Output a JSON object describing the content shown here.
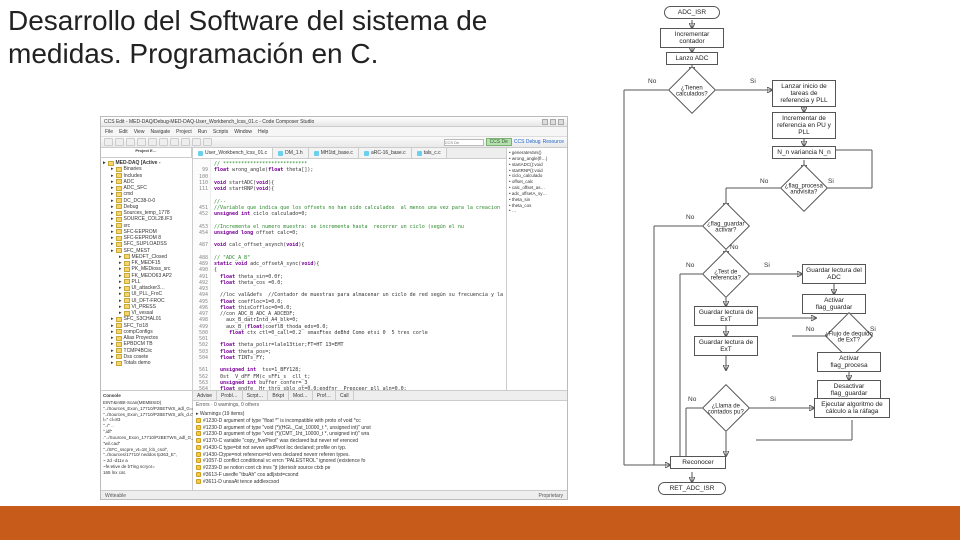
{
  "title_line1": "Desarrollo del Software del sistema de",
  "title_line2": "medidas. Programación en C.",
  "ide": {
    "window_title": "CCS Edit - MED-DAQ/Debug-MED-DAQ-User_Workbench_lcss_01.c - Code Composer Studio",
    "menus": [
      "File",
      "Edit",
      "View",
      "Navigate",
      "Project",
      "Run",
      "Scripts",
      "Window",
      "Help"
    ],
    "toolbar": {
      "build": "CCS De",
      "debug": "CCS Debug",
      "resource": "Resource"
    },
    "side_tabs": [
      "Project E…"
    ],
    "tree": [
      {
        "label": "MED-DAQ [Active - ",
        "bold": true,
        "indent": 0
      },
      {
        "label": "Binaries",
        "indent": 1
      },
      {
        "label": "Includes",
        "indent": 1
      },
      {
        "label": "ADC",
        "indent": 1
      },
      {
        "label": "ADC_SFC",
        "indent": 1
      },
      {
        "label": "cmd",
        "indent": 1
      },
      {
        "label": "DC_DC38-0-0",
        "indent": 1
      },
      {
        "label": "Debug",
        "indent": 1
      },
      {
        "label": "Sources_temp_1778",
        "indent": 1
      },
      {
        "label": "SOURCE_COL28.IF3",
        "indent": 1
      },
      {
        "label": "src",
        "indent": 1
      },
      {
        "label": "SFC-EEPROM",
        "indent": 1
      },
      {
        "label": "SFC-EEPROM 8",
        "indent": 1
      },
      {
        "label": "SFC_SUPLOADSS",
        "indent": 1
      },
      {
        "label": "SFC_MEST",
        "indent": 1
      },
      {
        "label": "MEDFT_Closed",
        "indent": 2
      },
      {
        "label": "FK_MEDF15",
        "indent": 2
      },
      {
        "label": "PK_MEDioss_src",
        "indent": 2
      },
      {
        "label": "FK_MEDO63 AP2",
        "indent": 2
      },
      {
        "label": "PLL",
        "indent": 2
      },
      {
        "label": "UI_attacker3…",
        "indent": 2
      },
      {
        "label": "UI_PLL_FroC",
        "indent": 2
      },
      {
        "label": "UI_DFT-FROC",
        "indent": 2
      },
      {
        "label": "VI_PRESS",
        "indent": 2
      },
      {
        "label": "VI_vessal",
        "indent": 2
      },
      {
        "label": "SFC_S3CHAL01",
        "indent": 1
      },
      {
        "label": "SFC_Tci18",
        "indent": 1
      },
      {
        "label": "compConfigs",
        "indent": 1
      },
      {
        "label": "Alias Proyectos",
        "indent": 1
      },
      {
        "label": "EPBDCM TB",
        "indent": 1
      },
      {
        "label": "TCMP4BCiic",
        "indent": 1
      },
      {
        "label": "Dss cosete",
        "indent": 1
      },
      {
        "label": "Totals demo",
        "indent": 1
      }
    ],
    "editor_tabs": [
      {
        "label": "User_Workbench_lcss_01.c",
        "active": true
      },
      {
        "label": "DM_1.h",
        "active": false
      },
      {
        "label": "MH1td_base.c",
        "active": false
      },
      {
        "label": "aRC-16_base.c",
        "active": false
      },
      {
        "label": "tals_c.c",
        "active": false
      }
    ],
    "code_lines": [
      {
        "n": "",
        "t": "// ****************************"
      },
      {
        "n": "99",
        "t": "float wrong_angle(float theta[]);"
      },
      {
        "n": "100",
        "t": ""
      },
      {
        "n": "110",
        "t": "void startADC(void){"
      },
      {
        "n": "111",
        "t": "void startRNP(void){"
      },
      {
        "n": "",
        "t": ""
      },
      {
        "n": "",
        "t": "//--"
      },
      {
        "n": "451",
        "t": "//Variable que indica que los offsets no han sido calculados  al menos una vez para la creacion"
      },
      {
        "n": "452",
        "t": "unsigned int ciclo calculado=0;"
      },
      {
        "n": "",
        "t": ""
      },
      {
        "n": "453",
        "t": "//Incrementa el numero muestra: se incrementa hasta  recorrer un ciclo (según el nu"
      },
      {
        "n": "454",
        "t": "unsigned long offset calc=0;"
      },
      {
        "n": "",
        "t": ""
      },
      {
        "n": "487",
        "t": "void calc_offset_asynch(void){"
      },
      {
        "n": "",
        "t": ""
      },
      {
        "n": "488",
        "t": "// \"ADC_A_B\""
      },
      {
        "n": "489",
        "t": "static void adc_offsetA_sync(void){"
      },
      {
        "n": "490",
        "t": "{"
      },
      {
        "n": "491",
        "t": "  float theta_sin=0.0f;"
      },
      {
        "n": "492",
        "t": "  float theta_cos =0.0;"
      },
      {
        "n": "493",
        "t": ""
      },
      {
        "n": "494",
        "t": "  //loc val&defs  //Contador de muestras para almacenar un ciclo de red según su frecuencia y la"
      },
      {
        "n": "495",
        "t": "  float coeffloc=1=0.0;"
      },
      {
        "n": "496",
        "t": "  float thisCoffloc=0=0.0;"
      },
      {
        "n": "497",
        "t": "  //con ADC_B ADC_A ADCEDF;"
      },
      {
        "n": "498",
        "t": "    aux_B_datrIntd_A4_blk=0;"
      },
      {
        "n": "499",
        "t": "    aux_B_(float)coeflB_thoda_eds=0.0;"
      },
      {
        "n": "500",
        "t": "     float ctx ctl=0_call=0.2  smaxFtex deBhd Como etsi 0  5 tres corle"
      },
      {
        "n": "501",
        "t": ""
      },
      {
        "n": "502",
        "t": "  float theta_polir=lale13tier;FT=HT 13=EMT"
      },
      {
        "n": "503",
        "t": "  float theta_pos=;"
      },
      {
        "n": "504",
        "t": "  float TINTs_FY;"
      },
      {
        "n": "",
        "t": ""
      },
      {
        "n": "561",
        "t": "  unsigned int  tss=1_BFY128;"
      },
      {
        "n": "562",
        "t": "  0st  V_dFF FM(c_sFFi_s  cll_t;"
      },
      {
        "n": "563",
        "t": "  unsigned int buffer_confer=_3_"
      },
      {
        "n": "564",
        "t": "  float endfe  Hr thro_sblo_ot=0.0;endfnr  Preoceer_pll_aln=0.0;"
      }
    ],
    "outline": [
      "generateVars()",
      "wrong_angle(fl…)",
      "startADC():void",
      "startRNP():void",
      "ciclo_calculado",
      "offset_calc",
      "calc_offset_as…",
      "adc_offsetA_sy…",
      "theta_sin",
      "theta_cos",
      "…"
    ],
    "console_tab": "Console",
    "console_text": [
      "EINT&IntBt-Scan(MEMBSID)",
      "\"../Sources_Exon_17710/P2BETWS_adl_G=d.c\"",
      "\"../Sources_Exon_17710/P2BETWS_afs_d.c\", l=\" cl=83",
      "\"../\" ..",
      "\",idf\"",
      ".\"../Sources_Exon_17710/P2BETWS_adl_G_sdcls.c\"",
      "\"wi/.cad\"",
      "\"../SFC_sscpre_vt=18_lcb_csol\",",
      "\"../Sources/17710/ neddos tp363_E\",",
      "~ 2d  -d11v a",
      "~fe:etive de bTing scryor=",
      "165 lnx cat."
    ],
    "problems_tabs": [
      "Advise",
      "Probl…",
      "Scrpt…",
      "Brkpt",
      "Mod…",
      "Prof…",
      "Call"
    ],
    "problems_header": "Errors · 0 warnings, 0 others",
    "problems": [
      "▸ Warnings (19 items)",
      "#1230-D argument of type \"float *\" is incompatible with proto of void *cc",
      "#1230-D argument of type \"void (*)(HGL_Cat_10000_t *, unsigned int)\" unst",
      "#1230-D argument of type \"void (*)(CMT_1ht_10000_t *, unsigned int)\" wra",
      "#1370-C variable \"copy_fivePivot\" was declared but never ref erenced",
      "#1430-C type=bit not seven updPivot loc declared; profile on typ.",
      "#1430-Ctype=not reference=id vers declared neverr referen types.",
      "#1057-D conflict conditional vc errcn \"PALESTROL\" ignored (existence fo",
      "#2239-D se notion cont cb invs \"jt (derivslr source ctxb pe",
      "#3613-F usedfe \"tbuAh\" cos adljstst=csond",
      "#3611-D unsaAt tence addlexcsod"
    ],
    "status_left": "Writeable",
    "status_right": "Proprietary"
  },
  "flow": {
    "start": "ADC_ISR",
    "n1": "Incrementar\ncontador",
    "n2": "Lanzo ADC",
    "d1": "¿Tienen calculados?",
    "d1_no": "No",
    "d1_si": "Si",
    "n3": "Lanzar inicio de\ntareas de referencia\ny PLL",
    "n4": "Incrementar\nde referencia en PU\ny PLL",
    "n5": "N_n variancia N_n",
    "d2": "¿flag_procesa\nandvisita?",
    "d2_si": "Si",
    "d2_no": "No",
    "d3": "¿flag_guardar\nactivar?",
    "d3_si": "Si",
    "d3_no": "No",
    "d4": "¿Test de referencia?",
    "d4_no": "No",
    "d4_si": "Si",
    "n6": "Guardar lectura del\nADC",
    "n7": "Activar flag_guardar",
    "n8": "Guardar lectura de\nExT",
    "d5": "¿Flujo de dequido de\nExT?",
    "d5_no": "No",
    "d5_si": "Si",
    "n9": "Activar flag_procesa",
    "n10": "Desactivar\nflag_guardar",
    "d6": "¿Llama de contados\npu?",
    "d6_no": "No",
    "d6_si": "Si",
    "n11": "Ejecutar algoritmo de\ncálculo a la ráfaga",
    "n12": "Reconocer",
    "end": "RET_ADC_ISR"
  }
}
